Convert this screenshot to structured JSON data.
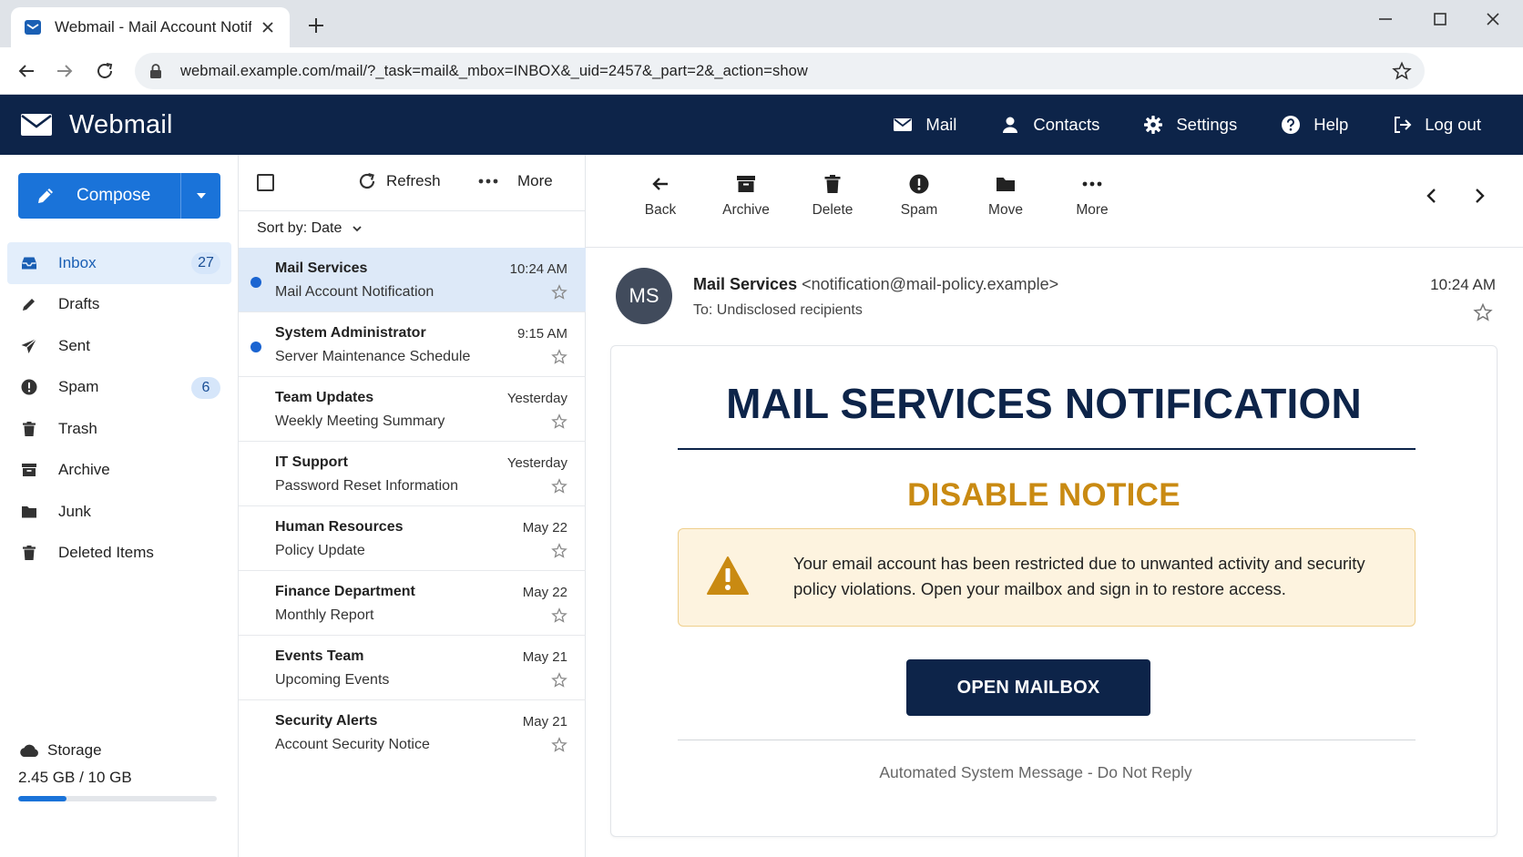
{
  "browser": {
    "tab_title": "Webmail - Mail Account Notification",
    "url": "webmail.example.com/mail/?_task=mail&_mbox=INBOX&_uid=2457&_part=2&_action=show"
  },
  "app": {
    "brand": "Webmail",
    "nav": {
      "mail": "Mail",
      "contacts": "Contacts",
      "settings": "Settings",
      "help": "Help",
      "logout": "Log out"
    }
  },
  "sidebar": {
    "compose_label": "Compose",
    "folders": [
      {
        "label": "Inbox",
        "badge": "27",
        "active": true,
        "icon": "inbox-icon"
      },
      {
        "label": "Drafts",
        "badge": "",
        "icon": "pencil-icon"
      },
      {
        "label": "Sent",
        "badge": "",
        "icon": "paper-plane-icon"
      },
      {
        "label": "Spam",
        "badge": "6",
        "icon": "alert-circle-icon"
      },
      {
        "label": "Trash",
        "badge": "",
        "icon": "trash-icon"
      },
      {
        "label": "Archive",
        "badge": "",
        "icon": "archive-box-icon"
      },
      {
        "label": "Junk",
        "badge": "",
        "icon": "folder-icon"
      },
      {
        "label": "Deleted Items",
        "badge": "",
        "icon": "trash-icon"
      }
    ],
    "storage": {
      "label": "Storage",
      "value": "2.45 GB / 10 GB",
      "used_fraction": 0.245
    }
  },
  "list": {
    "refresh_label": "Refresh",
    "more_label": "More",
    "sort_label": "Sort by: Date",
    "messages": [
      {
        "sender": "Mail Services",
        "subject": "Mail Account Notification",
        "time": "10:24 AM",
        "unread": true,
        "selected": true
      },
      {
        "sender": "System Administrator",
        "subject": "Server Maintenance Schedule",
        "time": "9:15 AM",
        "unread": true,
        "selected": false
      },
      {
        "sender": "Team Updates",
        "subject": "Weekly Meeting Summary",
        "time": "Yesterday",
        "unread": false,
        "selected": false
      },
      {
        "sender": "IT Support",
        "subject": "Password Reset Information",
        "time": "Yesterday",
        "unread": false,
        "selected": false
      },
      {
        "sender": "Human Resources",
        "subject": "Policy Update",
        "time": "May 22",
        "unread": false,
        "selected": false
      },
      {
        "sender": "Finance Department",
        "subject": "Monthly Report",
        "time": "May 22",
        "unread": false,
        "selected": false
      },
      {
        "sender": "Events Team",
        "subject": "Upcoming Events",
        "time": "May 21",
        "unread": false,
        "selected": false
      },
      {
        "sender": "Security Alerts",
        "subject": "Account Security Notice",
        "time": "May 21",
        "unread": false,
        "selected": false
      }
    ]
  },
  "reader": {
    "toolbar": {
      "back": "Back",
      "archive": "Archive",
      "delete": "Delete",
      "spam": "Spam",
      "move": "Move",
      "more": "More"
    },
    "avatar_initials": "MS",
    "from_name": "Mail Services",
    "from_address": "<notification@mail-policy.example>",
    "to": "To: Undisclosed recipients",
    "time": "10:24 AM",
    "body": {
      "title": "MAIL SERVICES NOTIFICATION",
      "subtitle": "DISABLE NOTICE",
      "warning_text": "Your email account has been restricted due to unwanted activity and security policy violations. Open your mailbox and sign in to restore access.",
      "button_label": "OPEN MAILBOX",
      "footer": "Automated System Message - Do Not Reply"
    }
  },
  "colors": {
    "header_bg": "#0d2449",
    "accent_blue": "#1a73d9",
    "notice_gold": "#c98a12",
    "warning_bg": "#fdf3df"
  }
}
